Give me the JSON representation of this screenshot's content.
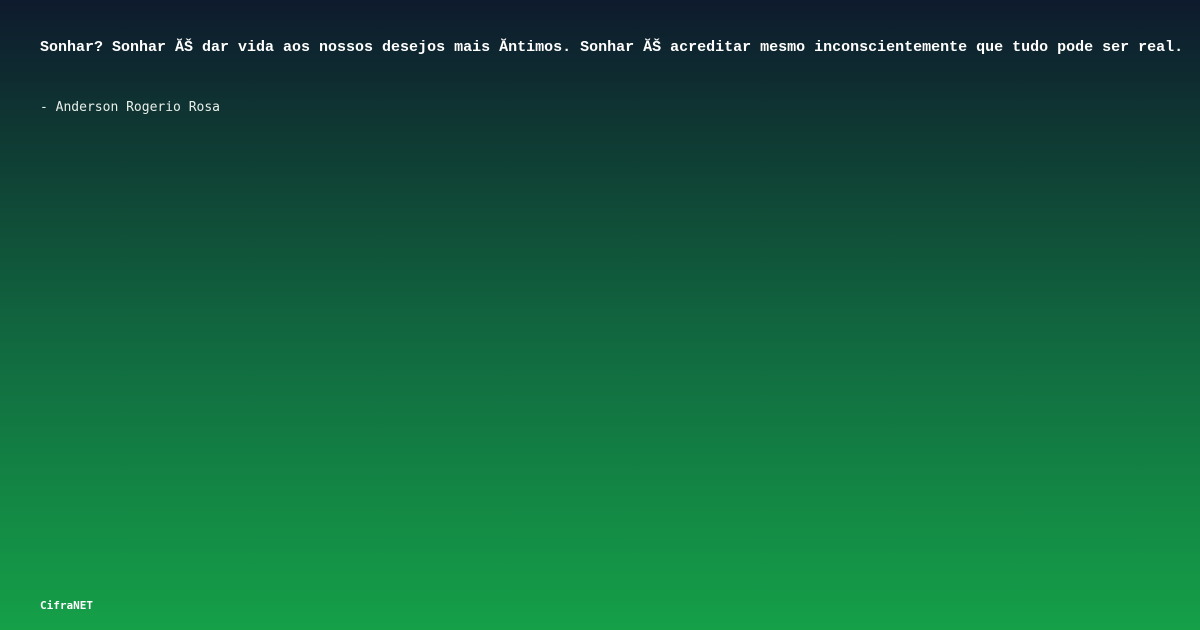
{
  "quote": {
    "text": "Sonhar? Sonhar ĂŠ dar vida aos nossos desejos mais Ă­ntimos. Sonhar ĂŠ acreditar mesmo inconscientemente que tudo pode ser real.",
    "author": "- Anderson Rogerio Rosa"
  },
  "brand": {
    "name": "CifraNET"
  },
  "colors": {
    "background_top": "#0e1a2d",
    "background_bottom": "#15a048",
    "text": "#ffffff"
  }
}
